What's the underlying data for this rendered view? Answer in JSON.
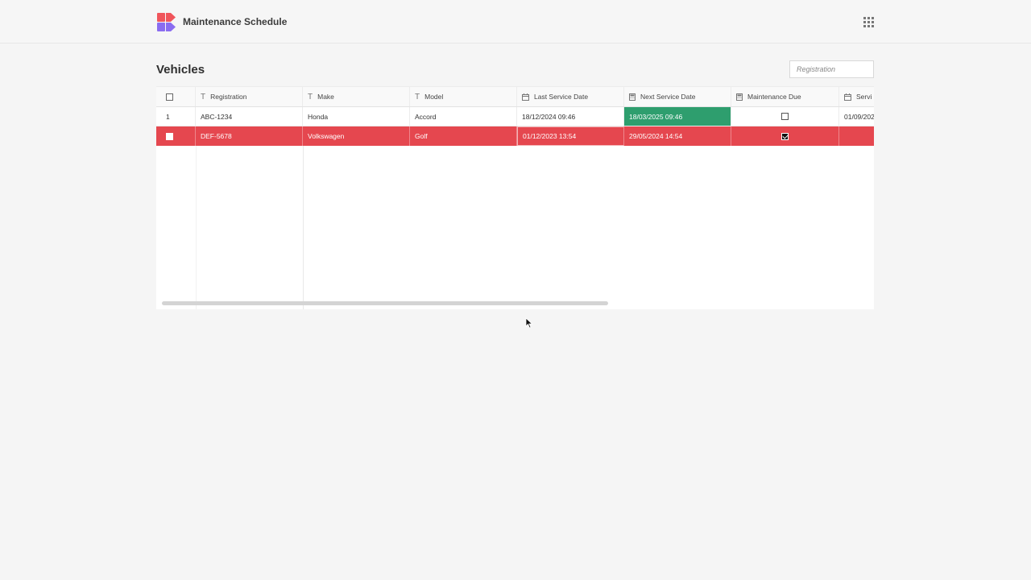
{
  "app": {
    "title": "Maintenance Schedule",
    "logo_icon": "app-logo-icon",
    "apps_icon": "grid-dots-icon"
  },
  "page": {
    "title": "Vehicles"
  },
  "search": {
    "placeholder": "Registration",
    "value": ""
  },
  "table": {
    "columns": [
      {
        "label": "",
        "icon": "checkbox"
      },
      {
        "label": "Registration",
        "icon": "text-type-icon"
      },
      {
        "label": "Make",
        "icon": "text-type-icon"
      },
      {
        "label": "Model",
        "icon": "text-type-icon"
      },
      {
        "label": "Last Service Date",
        "icon": "calendar-icon"
      },
      {
        "label": "Next Service Date",
        "icon": "calculator-icon"
      },
      {
        "label": "Maintenance Due",
        "icon": "calculator-icon"
      },
      {
        "label": "Servi",
        "icon": "calendar-icon"
      }
    ],
    "rows": [
      {
        "index": "1",
        "registration": "ABC-1234",
        "make": "Honda",
        "model": "Accord",
        "last_service": "18/12/2024 09:46",
        "next_service": "18/03/2025 09:46",
        "maintenance_due": false,
        "service": "01/09/202"
      },
      {
        "index": "",
        "registration": "DEF-5678",
        "make": "Volkswagen",
        "model": "Golf",
        "last_service": "01/12/2023 13:54",
        "next_service": "29/05/2024 14:54",
        "maintenance_due": true,
        "service": ""
      }
    ]
  },
  "colors": {
    "accent_red": "#e5474f",
    "accent_green": "#2e9e6e",
    "logo_red": "#f0555b",
    "logo_purple": "#8a6cf0"
  }
}
